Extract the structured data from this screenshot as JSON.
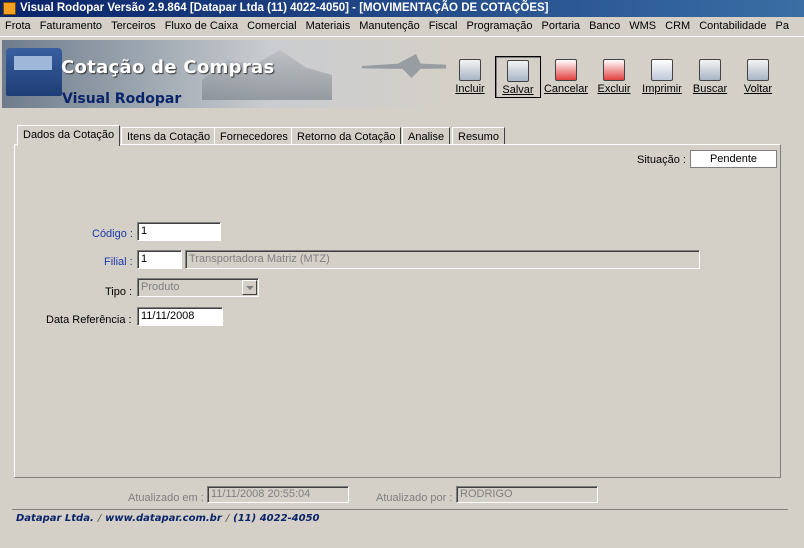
{
  "window": {
    "title": "Visual Rodopar Versão 2.9.864 [Datapar Ltda (11) 4022-4050]  - [MOVIMENTAÇÃO DE COTAÇÕES]"
  },
  "menu": [
    "Frota",
    "Faturamento",
    "Terceiros",
    "Fluxo de Caixa",
    "Comercial",
    "Materiais",
    "Manutenção",
    "Fiscal",
    "Programação",
    "Portaria",
    "Banco",
    "WMS",
    "CRM",
    "Contabilidade",
    "Pa"
  ],
  "banner": {
    "title": "Cotação de Compras",
    "subtitle": "Visual Rodopar"
  },
  "toolbar": {
    "incluir": "Incluir",
    "salvar": "Salvar",
    "cancelar": "Cancelar",
    "excluir": "Excluir",
    "imprimir": "Imprimir",
    "buscar": "Buscar",
    "voltar": "Voltar"
  },
  "tabs": [
    "Dados da Cotação",
    "Itens da Cotação",
    "Fornecedores",
    "Retorno da Cotação",
    "Analise",
    "Resumo"
  ],
  "form": {
    "situacao_label": "Situação :",
    "situacao_value": "Pendente",
    "codigo_label": "Código :",
    "codigo_value": "1",
    "filial_label": "Filial :",
    "filial_code": "1",
    "filial_name": "Transportadora Matriz (MTZ)",
    "tipo_label": "Tipo :",
    "tipo_value": "Produto",
    "data_label": "Data Referência :",
    "data_value": "11/11/2008"
  },
  "audit": {
    "atualizado_em_label": "Atualizado em :",
    "atualizado_em_value": "11/11/2008 20:55:04",
    "atualizado_por_label": "Atualizado por :",
    "atualizado_por_value": "RODRIGO"
  },
  "footer": {
    "company": "Datapar Ltda.",
    "site": "www.datapar.com.br",
    "phone": "(11) 4022-4050"
  }
}
